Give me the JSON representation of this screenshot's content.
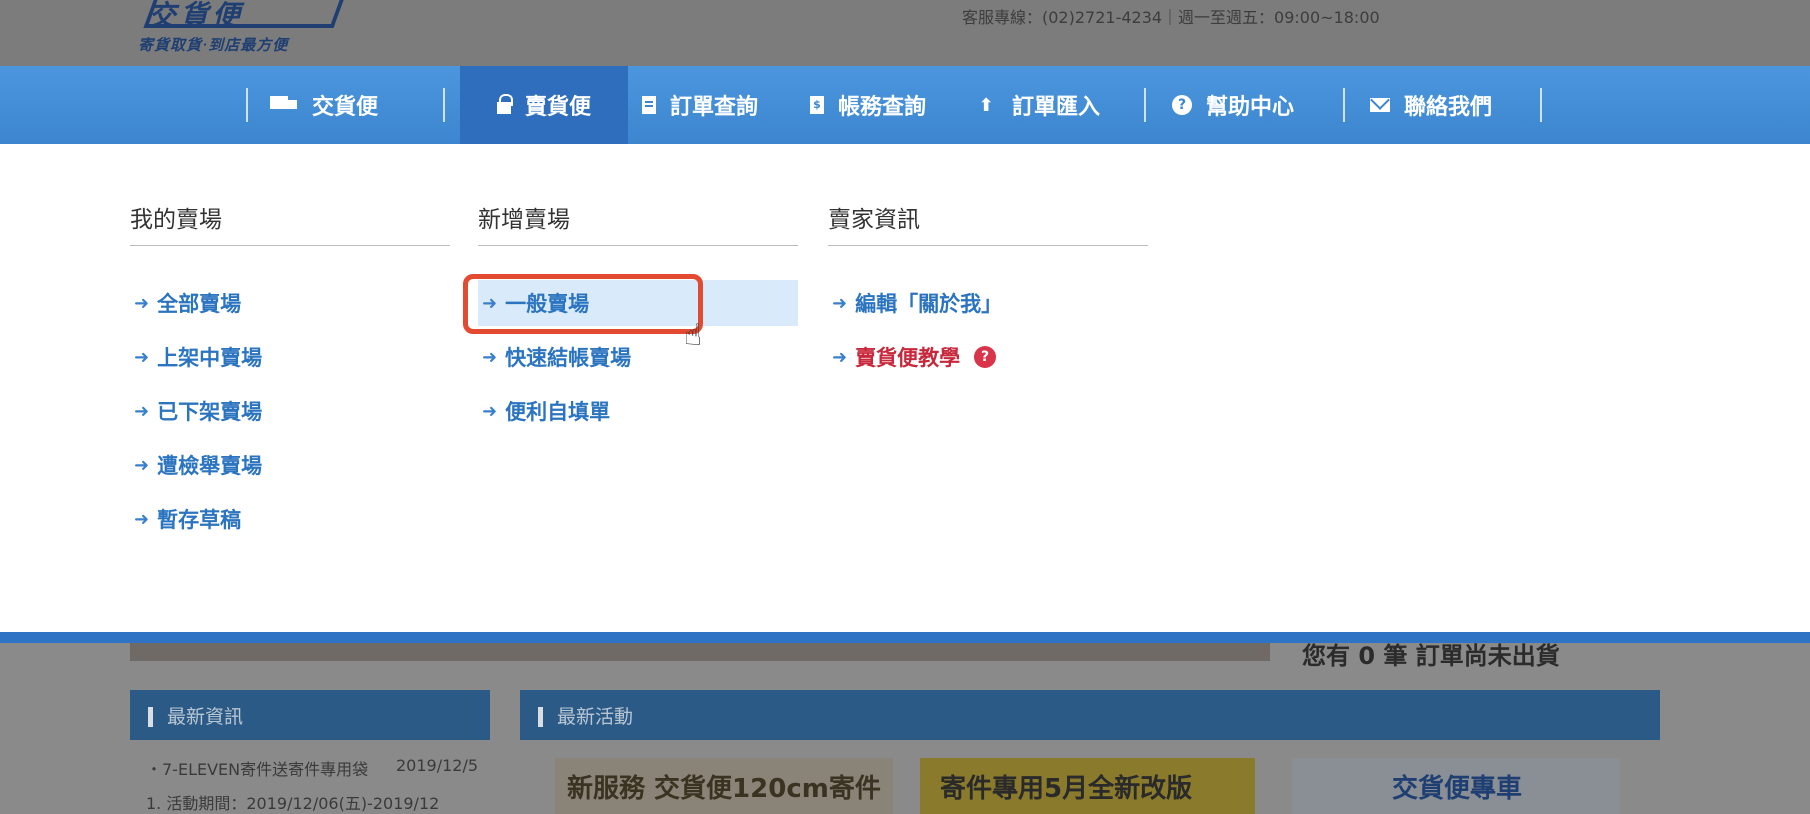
{
  "header": {
    "logo_text": "交貨便",
    "slogan": "寄貨取貨‧到店最方便",
    "service_line": "客服專線：(02)2721-4234｜週一至週五：09:00~18:00"
  },
  "nav": {
    "items": [
      {
        "label": "交貨便",
        "icon": "truck-icon"
      },
      {
        "label": "賣貨便",
        "icon": "lock-icon"
      },
      {
        "label": "訂單查詢",
        "icon": "document-icon"
      },
      {
        "label": "帳務查詢",
        "icon": "bill-icon"
      },
      {
        "label": "訂單匯入",
        "icon": "upload-icon"
      },
      {
        "label": "幫助中心",
        "icon": "help-icon"
      },
      {
        "label": "聯絡我們",
        "icon": "mail-icon"
      }
    ],
    "active_index": 1
  },
  "dropdown": {
    "columns": [
      {
        "title": "我的賣場",
        "links": [
          "全部賣場",
          "上架中賣場",
          "已下架賣場",
          "遭檢舉賣場",
          "暫存草稿"
        ]
      },
      {
        "title": "新增賣場",
        "links": [
          "一般賣場",
          "快速結帳賣場",
          "便利自填單"
        ]
      },
      {
        "title": "賣家資訊",
        "links": [
          "編輯「關於我」",
          "賣貨便教學"
        ]
      }
    ]
  },
  "lower": {
    "banner_text": "您有 0 筆 訂單尚未出貨",
    "news_title": "最新資訊",
    "activity_title": "最新活動",
    "news_item_1": "・7-ELEVEN寄件送寄件專用袋",
    "news_item_1_date": "2019/12/5",
    "news_item_2": "1. 活動期間：2019/12/06(五)-2019/12",
    "promo_1": "新服務 交貨便120cm寄件",
    "promo_2": "寄件專用5月全新改版",
    "promo_3": "交貨便專車"
  },
  "colors": {
    "nav_blue": "#3d86cf",
    "nav_active": "#2f6ebc",
    "link_blue": "#2b74c0",
    "highlight_red": "#e24a32",
    "tutorial_red": "#c8283c"
  }
}
